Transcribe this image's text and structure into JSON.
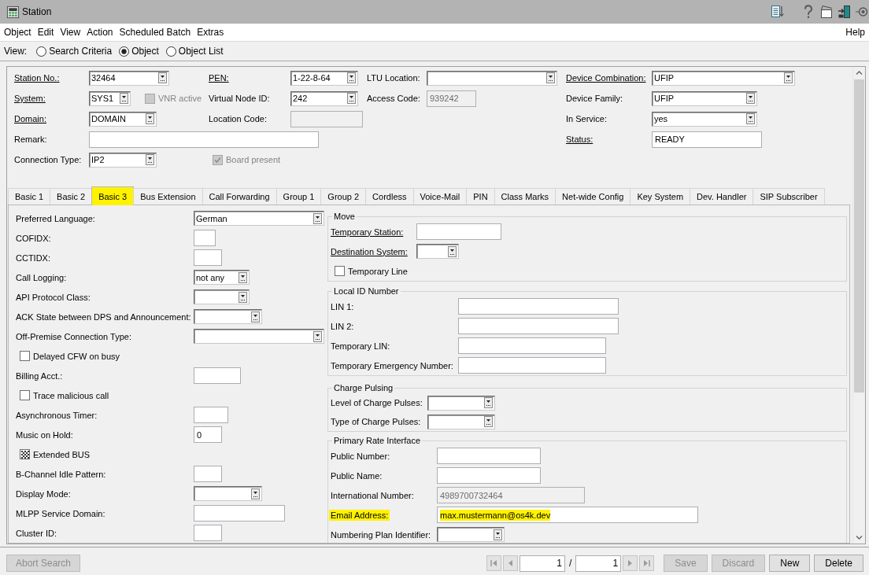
{
  "window": {
    "title": "Station"
  },
  "menu": {
    "items": [
      "Object",
      "Edit",
      "View",
      "Action",
      "Scheduled Batch",
      "Extras"
    ],
    "help": "Help"
  },
  "view_bar": {
    "label": "View:",
    "options": [
      {
        "label": "Search Criteria",
        "selected": false
      },
      {
        "label": "Object",
        "selected": true
      },
      {
        "label": "Object List",
        "selected": false
      }
    ]
  },
  "header": {
    "fields": [
      {
        "kind": "combo",
        "label": "Station No.:",
        "value": "32464",
        "mandatory": true,
        "disabled": false
      },
      {
        "kind": "combo",
        "label": "PEN:",
        "value": "1-22-8-64",
        "mandatory": true,
        "disabled": false
      },
      {
        "kind": "combo",
        "label": "LTU Location:",
        "mandatory": false,
        "disabled": false
      },
      {
        "kind": "combo",
        "label": "Device Combination:",
        "value": "UFIP",
        "mandatory": true,
        "disabled": false
      },
      {
        "kind": "combo",
        "label": "System:",
        "value": "SYS1",
        "mandatory": true,
        "disabled": false
      },
      {
        "kind": "checkbox",
        "label": "VNR active",
        "checked": false,
        "disabled": true
      },
      {
        "kind": "combo",
        "label": "Virtual Node ID:",
        "value": "242",
        "mandatory": false,
        "disabled": false
      },
      {
        "kind": "text",
        "label": "Access Code:",
        "value": "939242",
        "mandatory": false,
        "disabled": true
      },
      {
        "kind": "combo",
        "label": "Device Family:",
        "value": "UFIP",
        "mandatory": false,
        "disabled": false
      },
      {
        "kind": "combo",
        "label": "Domain:",
        "value": "DOMAIN",
        "mandatory": true,
        "disabled": false
      },
      {
        "kind": "text",
        "label": "Location Code:",
        "mandatory": false,
        "disabled": true
      },
      {
        "kind": "combo",
        "label": "In Service:",
        "value": "yes",
        "mandatory": false,
        "disabled": false
      },
      {
        "kind": "text",
        "label": "Remark:",
        "mandatory": false,
        "disabled": false
      },
      {
        "kind": "text",
        "label": "Status:",
        "value": "READY",
        "mandatory": true,
        "disabled": false
      },
      {
        "kind": "combo",
        "label": "Connection Type:",
        "value": "IP2",
        "mandatory": false,
        "disabled": false
      },
      {
        "kind": "checkbox",
        "label": "Board present",
        "checked": true,
        "disabled": true
      }
    ]
  },
  "tabs": [
    {
      "label": "Basic 1",
      "selected": false,
      "highlighted": false
    },
    {
      "label": "Basic 2",
      "selected": false,
      "highlighted": false
    },
    {
      "label": "Basic 3",
      "selected": true,
      "highlighted": true
    },
    {
      "label": "Bus Extension",
      "selected": false,
      "highlighted": false
    },
    {
      "label": "Call Forwarding",
      "selected": false,
      "highlighted": false
    },
    {
      "label": "Group 1",
      "selected": false,
      "highlighted": false
    },
    {
      "label": "Group 2",
      "selected": false,
      "highlighted": false
    },
    {
      "label": "Cordless",
      "selected": false,
      "highlighted": false
    },
    {
      "label": "Voice-Mail",
      "selected": false,
      "highlighted": false
    },
    {
      "label": "PIN",
      "selected": false,
      "highlighted": false
    },
    {
      "label": "Class Marks",
      "selected": false,
      "highlighted": false
    },
    {
      "label": "Net-wide Config",
      "selected": false,
      "highlighted": false
    },
    {
      "label": "Key System",
      "selected": false,
      "highlighted": false
    },
    {
      "label": "Dev. Handler",
      "selected": false,
      "highlighted": false
    },
    {
      "label": "SIP Subscriber",
      "selected": false,
      "highlighted": false
    }
  ],
  "tab_content": {
    "fields": [
      {
        "kind": "combo",
        "label": "Preferred Language:",
        "value": "German"
      },
      {
        "kind": "text",
        "label": "COFIDX:"
      },
      {
        "kind": "text",
        "label": "CCTIDX:"
      },
      {
        "kind": "combo",
        "label": "Call Logging:",
        "value": "not any"
      },
      {
        "kind": "combo",
        "label": "API Protocol Class:"
      },
      {
        "kind": "combo",
        "label": "ACK State between DPS and Announcement:"
      },
      {
        "kind": "combo",
        "label": "Off-Premise Connection Type:"
      },
      {
        "kind": "checkbox",
        "label": "Delayed CFW on busy",
        "checked": false,
        "indeterminate": false
      },
      {
        "kind": "text",
        "label": "Billing Acct.:"
      },
      {
        "kind": "checkbox",
        "label": "Trace malicious call",
        "checked": false,
        "indeterminate": false
      },
      {
        "kind": "text",
        "label": "Asynchronous Timer:"
      },
      {
        "kind": "text",
        "label": "Music on Hold:",
        "value": "0"
      },
      {
        "kind": "checkbox",
        "label": "Extended BUS",
        "checked": false,
        "indeterminate": true
      },
      {
        "kind": "text",
        "label": "B-Channel Idle Pattern:"
      },
      {
        "kind": "combo",
        "label": "Display Mode:"
      },
      {
        "kind": "text",
        "label": "MLPP Service Domain:"
      },
      {
        "kind": "text",
        "label": "Cluster ID:"
      }
    ],
    "groups": [
      {
        "title": "Move",
        "fields": [
          {
            "kind": "text",
            "label": "Temporary Station:",
            "mandatory": true
          },
          {
            "kind": "combo",
            "label": "Destination System:",
            "mandatory": true
          },
          {
            "kind": "checkbox",
            "label": "Temporary Line",
            "checked": false
          }
        ]
      },
      {
        "title": "Local ID Number",
        "fields": [
          {
            "kind": "text",
            "label": "LIN 1:"
          },
          {
            "kind": "text",
            "label": "LIN 2:"
          },
          {
            "kind": "text",
            "label": "Temporary LIN:"
          },
          {
            "kind": "text",
            "label": "Temporary Emergency Number:"
          }
        ]
      },
      {
        "title": "Charge Pulsing",
        "fields": [
          {
            "kind": "combo",
            "label": "Level of Charge Pulses:"
          },
          {
            "kind": "combo",
            "label": "Type of Charge Pulses:"
          }
        ]
      },
      {
        "title": "Primary Rate Interface",
        "fields": [
          {
            "kind": "text",
            "label": "Public Number:",
            "disabled": false,
            "highlighted": false
          },
          {
            "kind": "text",
            "label": "Public Name:",
            "disabled": false,
            "highlighted": false
          },
          {
            "kind": "text",
            "label": "International Number:",
            "value": "4989700732464",
            "disabled": true,
            "highlighted": false
          },
          {
            "kind": "text",
            "label": "Email Address:",
            "value": "max.mustermann@os4k.dev",
            "disabled": false,
            "highlighted": true
          },
          {
            "kind": "combo",
            "label": "Numbering Plan Identifier:",
            "disabled": false,
            "highlighted": false
          }
        ]
      }
    ]
  },
  "footer": {
    "abort": {
      "label": "Abort Search",
      "disabled": true
    },
    "pager": {
      "page": "1",
      "separator": "/",
      "total": "1"
    },
    "buttons": [
      {
        "label": "Save",
        "disabled": true
      },
      {
        "label": "Discard",
        "disabled": true
      },
      {
        "label": "New",
        "disabled": false
      },
      {
        "label": "Delete",
        "disabled": false
      }
    ]
  }
}
